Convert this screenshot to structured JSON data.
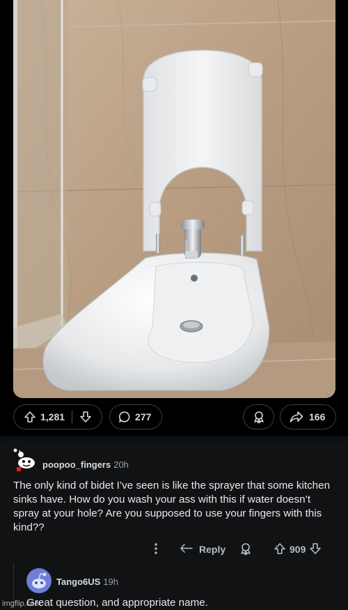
{
  "post": {
    "upvotes": "1,281",
    "comments": "277",
    "shares": "166"
  },
  "comment1": {
    "username": "poopoo_fingers",
    "age": "20h",
    "body": "The only kind of bidet I’ve seen is like the sprayer that some kitchen sinks have. How do you wash your ass with this if water doesn’t spray at your hole? Are you supposed to use your fingers with this kind??",
    "reply_label": "Reply",
    "score": "909"
  },
  "comment2": {
    "username": "Tango6US",
    "age": "19h",
    "body": "Great question, and appropriate name."
  },
  "watermark": "imgflip.com",
  "colors": {
    "background": "#000000",
    "comment_bg": "#101214",
    "pill_border": "#3a3d40",
    "text": "#e8eaed",
    "muted": "#9ba0a4"
  },
  "icons": {
    "upvote": "arrow-up-icon",
    "downvote": "arrow-down-icon",
    "comment": "speech-bubble-icon",
    "award": "award-icon",
    "share": "share-arrow-icon",
    "more": "vertical-ellipsis-icon",
    "reply": "reply-arrow-icon"
  }
}
